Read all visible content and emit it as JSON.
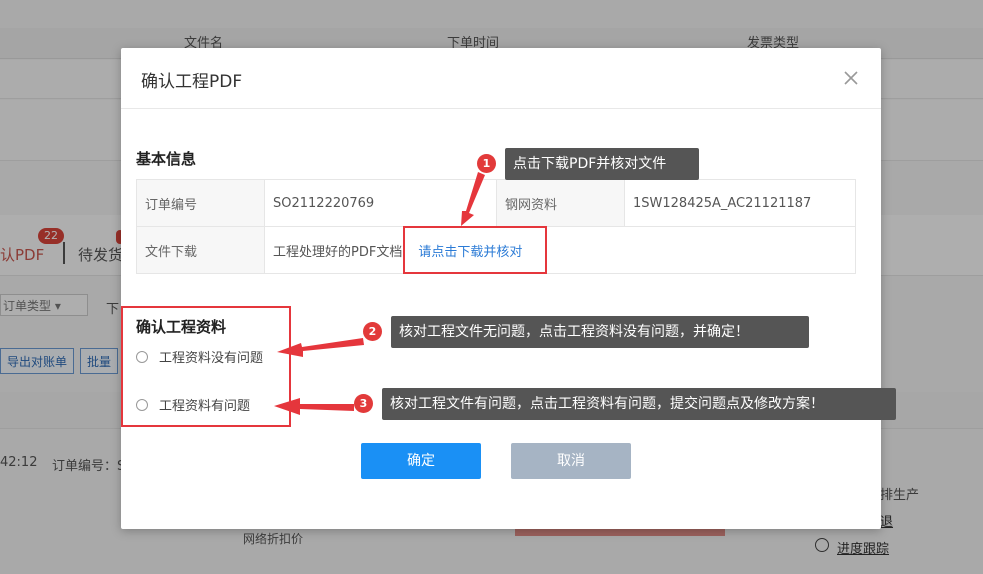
{
  "background": {
    "columns": [
      "文件名",
      "下单时间",
      "发票类型"
    ],
    "tabs": {
      "active": "认PDF",
      "active_badge": "22",
      "next": "待发货"
    },
    "filter_select": "订单类型",
    "filter_text": "下",
    "buttons": [
      "导出对账单",
      "批量"
    ],
    "time_fragment": "42:12",
    "order_fragment": "订单编号：S",
    "discount_label": "网络折扣价",
    "right_text": "排生产",
    "right_link_1": "退",
    "right_link_2": "进度跟踪"
  },
  "modal": {
    "title": "确认工程PDF",
    "basic_info_title": "基本信息",
    "rows": [
      {
        "label1": "订单编号",
        "value1": "SO2112220769",
        "label2": "钢网资料",
        "value2": "1SW128425A_AC21121187"
      },
      {
        "label1": "文件下载",
        "value1": "工程处理好的PDF文档",
        "link": "请点击下载并核对"
      }
    ],
    "confirm_section_title": "确认工程资料",
    "options": [
      "工程资料没有问题",
      "工程资料有问题"
    ],
    "ok_label": "确定",
    "cancel_label": "取消"
  },
  "annotations": [
    {
      "number": "1",
      "text": "点击下载PDF并核对文件"
    },
    {
      "number": "2",
      "text": "核对工程文件无问题，点击工程资料没有问题，并确定！"
    },
    {
      "number": "3",
      "text": "核对工程文件有问题，点击工程资料有问题，提交问题点及修改方案！"
    }
  ],
  "colors": {
    "primary": "#1a90f5",
    "cancel": "#a6b4c4",
    "link": "#2b7bd6",
    "annotation_red": "#e5363c",
    "tooltip_bg": "#555555"
  }
}
